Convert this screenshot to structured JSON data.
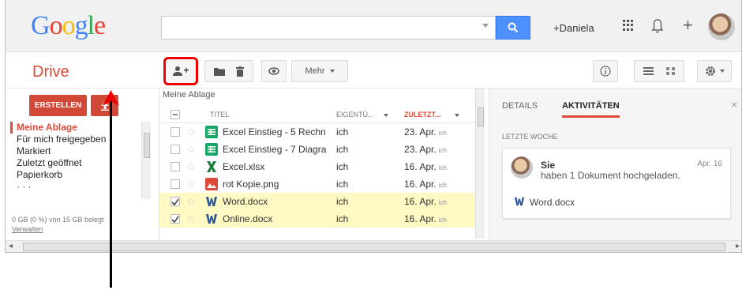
{
  "logo": [
    "G",
    "o",
    "o",
    "g",
    "l",
    "e"
  ],
  "header": {
    "user": "+Daniela",
    "icons": [
      "search-icon",
      "apps-icon",
      "bell-icon",
      "plus-icon",
      "avatar"
    ]
  },
  "toolbar": {
    "title": "Drive",
    "more_label": "Mehr"
  },
  "sidebar": {
    "create_label": "ERSTELLEN",
    "items": [
      "Meine Ablage",
      "Für mich freigegeben",
      "Markiert",
      "Zuletzt geöffnet",
      "Papierkorb",
      "· · ·"
    ],
    "storage": "0 GB (0 %) von 15 GB belegt",
    "manage": "Verwalten"
  },
  "files": {
    "breadcrumb": "Meine Ablage",
    "columns": {
      "title": "TITEL",
      "owner": "EIGENTÜ...",
      "modified": "ZULETZT..."
    },
    "rows": [
      {
        "name": "Excel Einstieg - 5 Rechn",
        "owner": "ich",
        "date": "23. Apr.",
        "by": "ich",
        "icon": "sheets",
        "selected": false
      },
      {
        "name": "Excel Einstieg - 7 Diagra",
        "owner": "ich",
        "date": "23. Apr.",
        "by": "ich",
        "icon": "sheets",
        "selected": false
      },
      {
        "name": "Excel.xlsx",
        "owner": "ich",
        "date": "16. Apr.",
        "by": "ich",
        "icon": "excel",
        "selected": false
      },
      {
        "name": "rot Kopie.png",
        "owner": "ich",
        "date": "16. Apr.",
        "by": "ich",
        "icon": "image",
        "selected": false
      },
      {
        "name": "Word.docx",
        "owner": "ich",
        "date": "16. Apr.",
        "by": "ich",
        "icon": "word",
        "selected": true
      },
      {
        "name": "Online.docx",
        "owner": "ich",
        "date": "16. Apr.",
        "by": "ich",
        "icon": "word",
        "selected": true
      }
    ]
  },
  "details": {
    "tab_details": "DETAILS",
    "tab_activity": "AKTIVITÄTEN",
    "week": "LETZTE WOCHE",
    "card": {
      "who": "Sie",
      "what": "haben 1 Dokument hochgeladen.",
      "date": "Apr. 16",
      "file": "Word.docx"
    }
  },
  "colors": {
    "accent": "#dd4b39",
    "search": "#4d90fe",
    "highlight": "#ff0000",
    "selected_row": "#fff9c4"
  }
}
